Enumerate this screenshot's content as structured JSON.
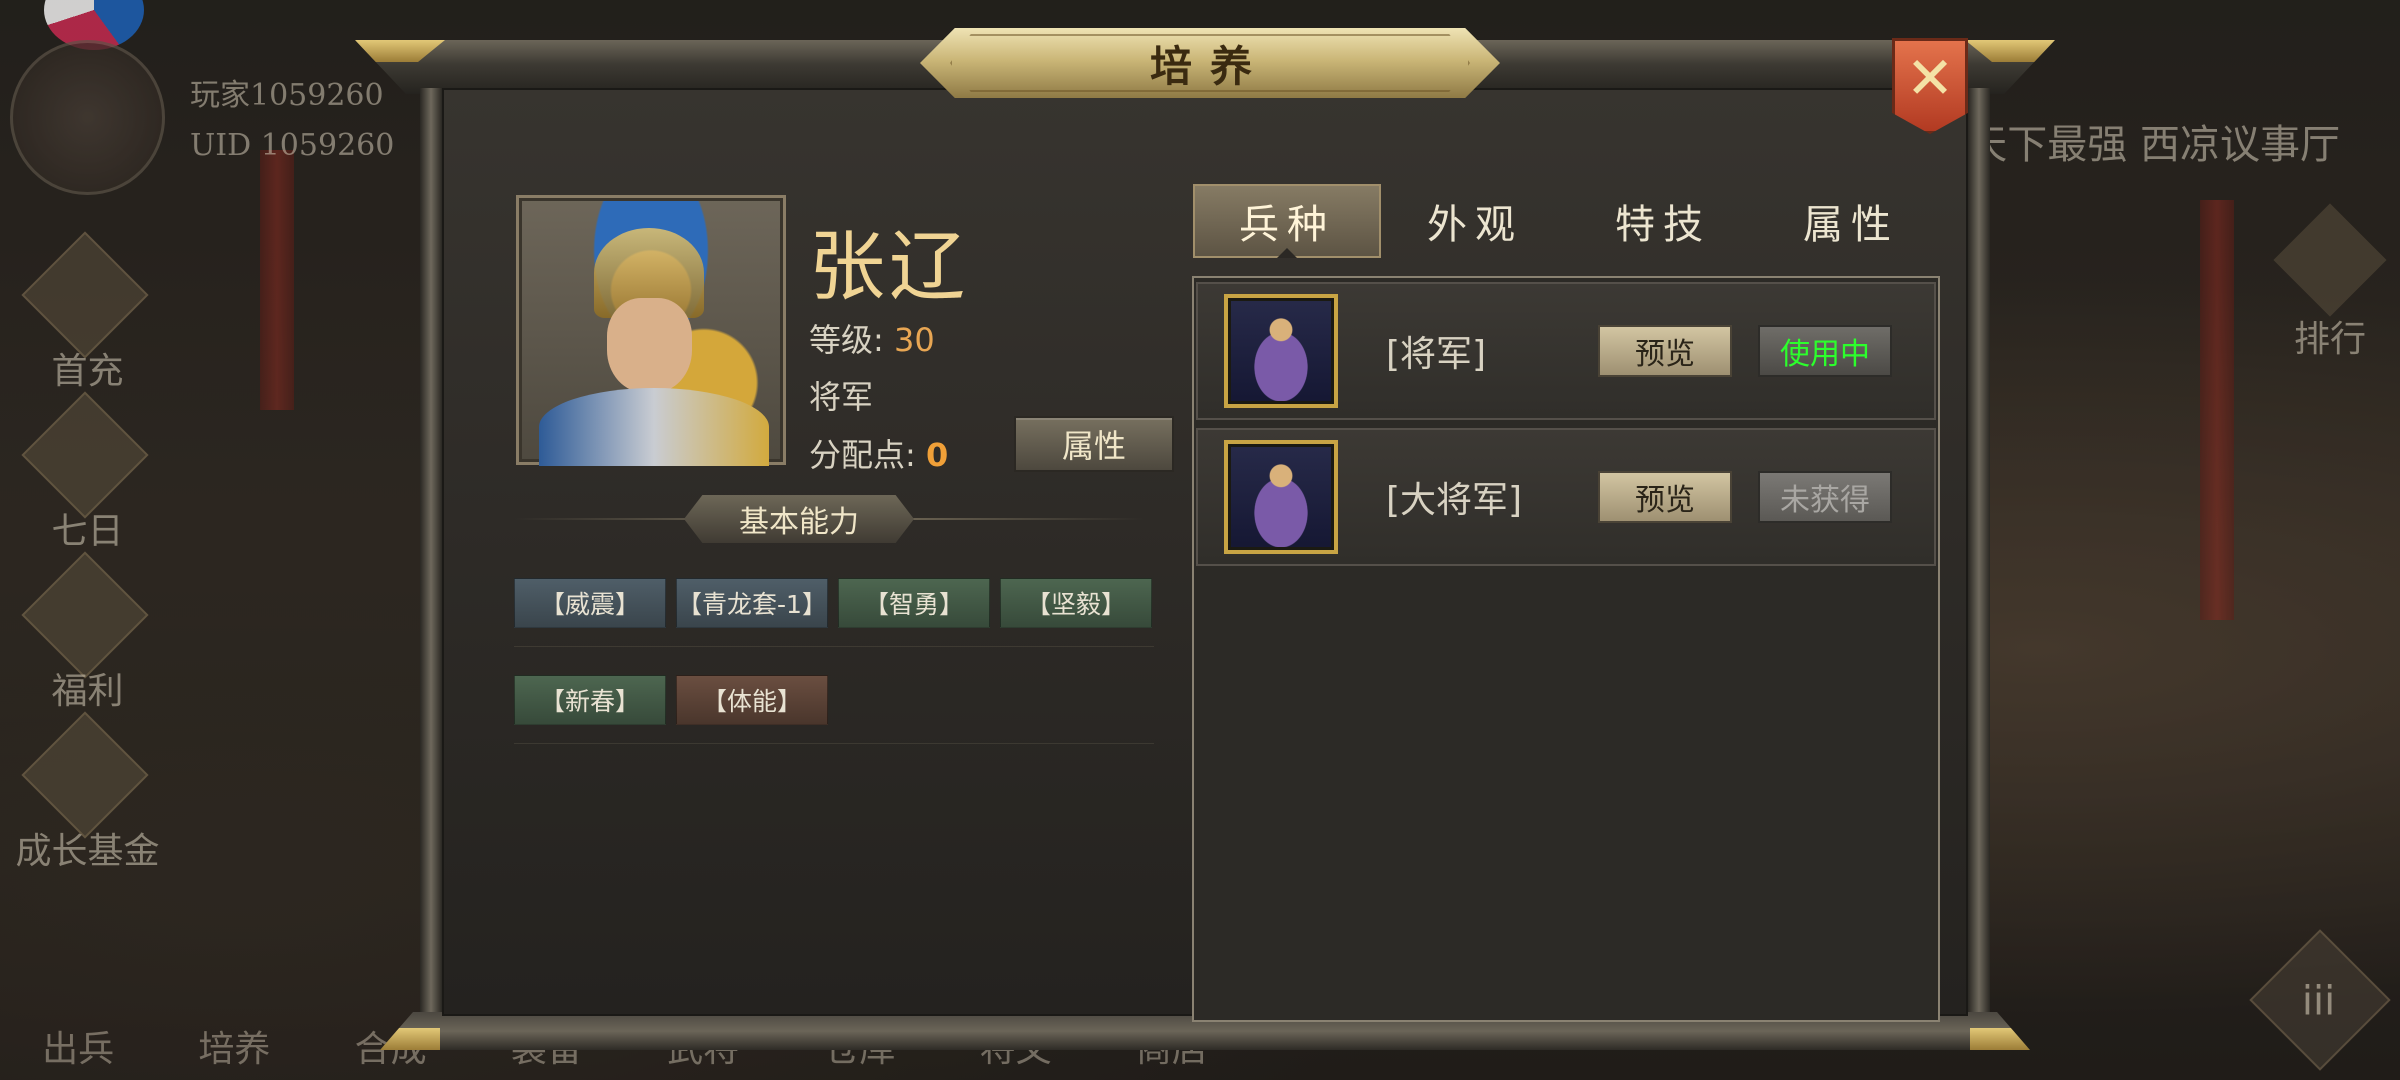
{
  "background": {
    "player_name": "玩家1059260",
    "player_uid": "UID  1059260",
    "left_menu": [
      {
        "label": "首充",
        "icon": "gift-icon"
      },
      {
        "label": "七日",
        "icon": "calendar-icon"
      },
      {
        "label": "福利",
        "icon": "bonus-icon"
      },
      {
        "label": "成长基金",
        "icon": "coin-icon"
      }
    ],
    "bottom_menu": [
      "出兵",
      "培养",
      "合成",
      "装备",
      "武将",
      "仓库",
      "将文",
      "商店"
    ],
    "right_text": "天下最强 西凉议事厅",
    "right_rank_label": "排行",
    "more_label": "iii"
  },
  "dialog": {
    "title": "培养",
    "close_icon": "close-icon",
    "hero": {
      "name": "张辽",
      "level_label": "等级:",
      "level_value": "30",
      "rank": "将军",
      "points_label": "分配点:",
      "points_value": "0",
      "attr_button": "属性"
    },
    "section_title": "基本能力",
    "tags": [
      [
        {
          "label": "【威震】",
          "color": "blue"
        },
        {
          "label": "【青龙套-1】",
          "color": "blue"
        },
        {
          "label": "【智勇】",
          "color": "green"
        },
        {
          "label": "【坚毅】",
          "color": "green"
        }
      ],
      [
        {
          "label": "【新春】",
          "color": "green"
        },
        {
          "label": "【体能】",
          "color": "brown"
        }
      ]
    ],
    "tabs": [
      {
        "label": "兵种",
        "active": true
      },
      {
        "label": "外观",
        "active": false
      },
      {
        "label": "特技",
        "active": false
      },
      {
        "label": "属性",
        "active": false
      }
    ],
    "units": [
      {
        "name": "[将军]",
        "preview": "预览",
        "status": "使用中",
        "status_type": "inuse"
      },
      {
        "name": "[大将军]",
        "preview": "预览",
        "status": "未获得",
        "status_type": "locked"
      }
    ]
  },
  "colors": {
    "gold_text": "#f0d494",
    "orange_value": "#e8a653",
    "in_use_green": "#2cff2c",
    "close_red": "#c4482c"
  }
}
